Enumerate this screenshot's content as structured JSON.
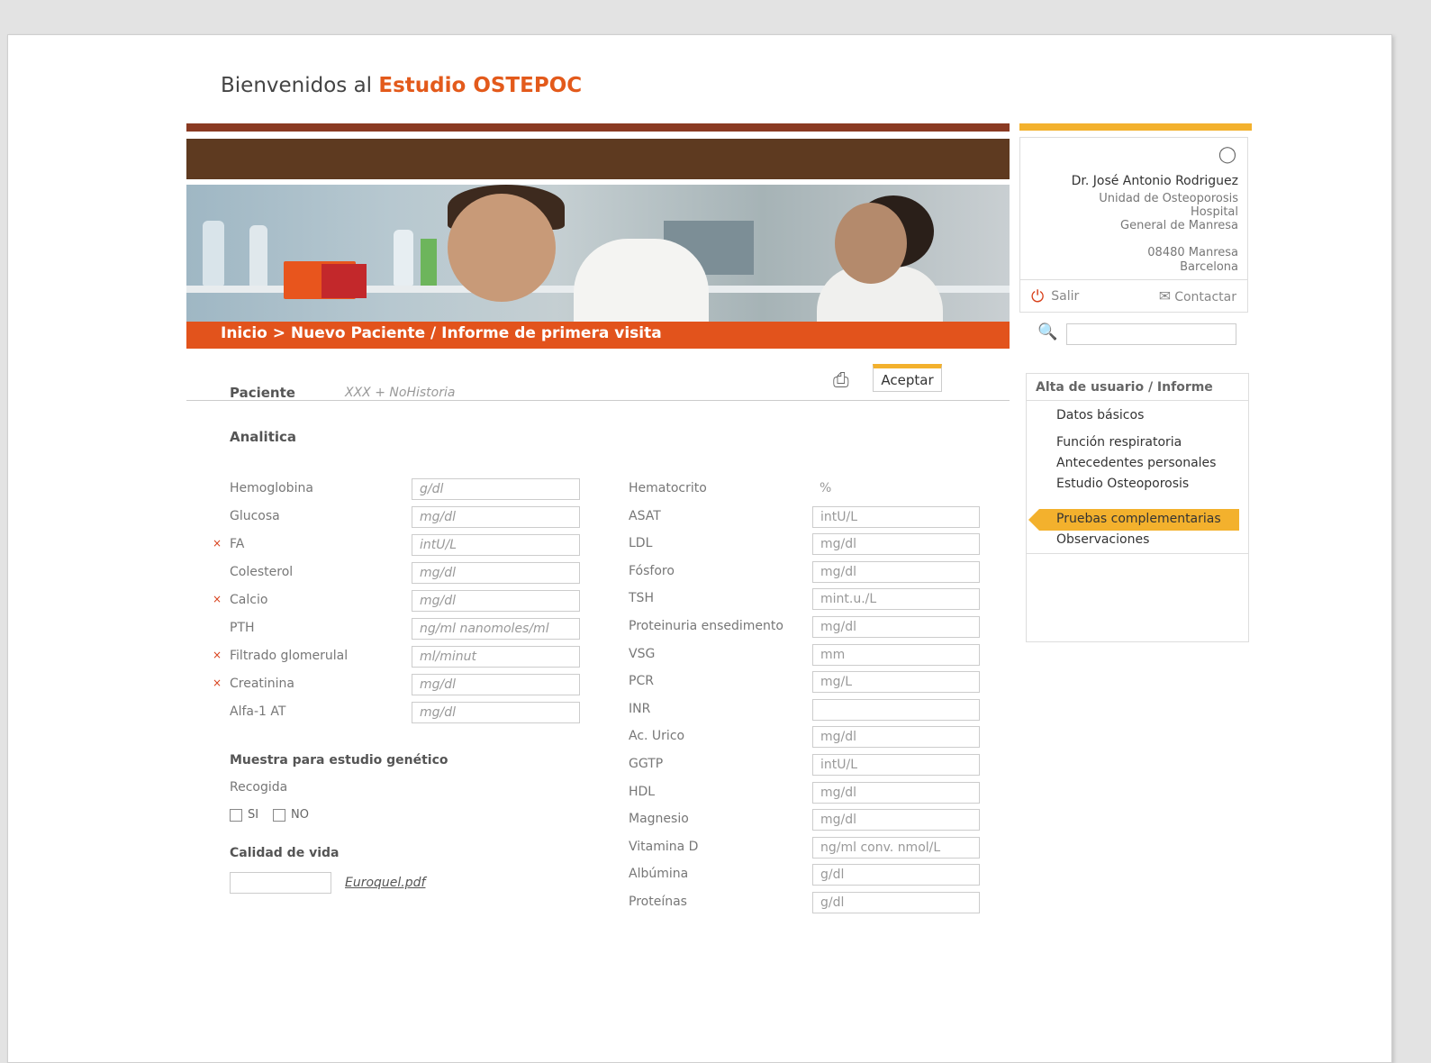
{
  "header": {
    "welcome_prefix": "Bienvenidos al",
    "welcome_brand": "Estudio OSTEPOC",
    "breadcrumb": "Inicio > Nuevo Paciente / Informe de primera visita"
  },
  "user": {
    "name": "Dr. José Antonio Rodriguez",
    "unit": "Unidad de Osteoporosis",
    "hospital1": "Hospital",
    "hospital2": "General de Manresa",
    "postal": "08480 Manresa",
    "city": "Barcelona",
    "logout": "Salir",
    "contact": "Contactar"
  },
  "search": {
    "placeholder": ""
  },
  "menu": {
    "title": "Alta de usuario / Informe",
    "items": [
      "Datos básicos",
      "Función respiratoria",
      "Antecedentes personales",
      "Estudio Osteoporosis",
      "Pruebas complementarias",
      "Observaciones"
    ],
    "active": "Pruebas complementarias"
  },
  "patient": {
    "label": "Paciente",
    "value": "XXX + NoHistoria"
  },
  "toolbar": {
    "accept": "Aceptar"
  },
  "section": {
    "title": "Analitica"
  },
  "left_fields": [
    {
      "label": "Hemoglobina",
      "unit": "g/dl",
      "required": false
    },
    {
      "label": "Glucosa",
      "unit": "mg/dl",
      "required": false
    },
    {
      "label": "FA",
      "unit": "intU/L",
      "required": true
    },
    {
      "label": "Colesterol",
      "unit": "mg/dl",
      "required": false
    },
    {
      "label": "Calcio",
      "unit": "mg/dl",
      "required": true
    },
    {
      "label": "PTH",
      "unit": "ng/ml nanomoles/ml",
      "required": false
    },
    {
      "label": "Filtrado glomerulal",
      "unit": "ml/minut",
      "required": true
    },
    {
      "label": "Creatinina",
      "unit": "mg/dl",
      "required": true
    },
    {
      "label": "Alfa-1 AT",
      "unit": "mg/dl",
      "required": false
    }
  ],
  "right_fields": [
    {
      "label": "Hematocrito",
      "unit": "%"
    },
    {
      "label": "ASAT",
      "unit": "intU/L"
    },
    {
      "label": "LDL",
      "unit": "mg/dl"
    },
    {
      "label": "Fósforo",
      "unit": "mg/dl"
    },
    {
      "label": "TSH",
      "unit": "mint.u./L"
    },
    {
      "label": "Proteinuria ensedimento",
      "unit": "mg/dl"
    },
    {
      "label": "VSG",
      "unit": "mm"
    },
    {
      "label": "PCR",
      "unit": "mg/L"
    },
    {
      "label": "INR",
      "unit": ""
    },
    {
      "label": "Ac. Urico",
      "unit": "mg/dl"
    },
    {
      "label": "GGTP",
      "unit": "intU/L"
    },
    {
      "label": "HDL",
      "unit": "mg/dl"
    },
    {
      "label": "Magnesio",
      "unit": "mg/dl"
    },
    {
      "label": "Vitamina D",
      "unit": "ng/ml conv. nmol/L"
    },
    {
      "label": "Albúmina",
      "unit": "g/dl"
    },
    {
      "label": "Proteínas",
      "unit": "g/dl"
    }
  ],
  "genetic": {
    "title": "Muestra para estudio genético",
    "label": "Recogida",
    "yes": "SI",
    "no": "NO"
  },
  "quality": {
    "title": "Calidad de vida",
    "link": "Euroquel.pdf"
  },
  "colors": {
    "brand_orange": "#e2531c",
    "accent_yellow": "#f3b12d",
    "rust": "#8a3a22",
    "brown": "#5e3a20"
  }
}
